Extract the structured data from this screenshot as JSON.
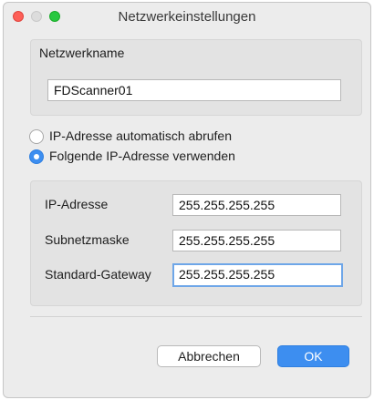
{
  "window": {
    "title": "Netzwerkeinstellungen"
  },
  "network_name": {
    "label": "Netzwerkname",
    "value": "FDScanner01"
  },
  "address_mode": {
    "options": [
      {
        "label": "IP-Adresse automatisch abrufen",
        "selected": false
      },
      {
        "label": "Folgende IP-Adresse verwenden",
        "selected": true
      }
    ]
  },
  "ip_settings": {
    "ip_address": {
      "label": "IP-Adresse",
      "value": "255.255.255.255"
    },
    "subnet_mask": {
      "label": "Subnetzmaske",
      "value": "255.255.255.255"
    },
    "gateway": {
      "label": "Standard-Gateway",
      "value": "255.255.255.255"
    }
  },
  "buttons": {
    "cancel": "Abbrechen",
    "ok": "OK"
  },
  "colors": {
    "accent": "#3d8ef0",
    "focus_ring": "#6ea6e8",
    "window_bg": "#ececec"
  }
}
